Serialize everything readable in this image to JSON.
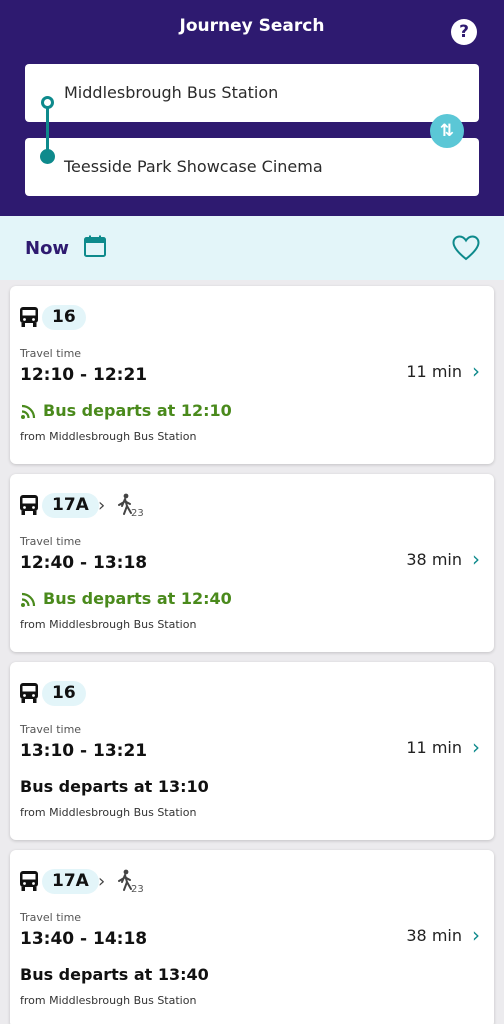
{
  "header": {
    "title": "Journey Search",
    "help_label": "?",
    "from": "Middlesbrough Bus Station",
    "to": "Teesside Park Showcase Cinema",
    "swap_label": "⇅"
  },
  "time_bar": {
    "now_label": "Now"
  },
  "colors": {
    "header_bg": "#2e1a70",
    "accent_teal": "#0e8a8c",
    "swap_btn": "#5bc7d6",
    "live_green": "#4a8a1c",
    "time_bar_bg": "#e3f5f9"
  },
  "icons": {
    "calendar": "calendar-icon",
    "favourite": "heart-icon",
    "bus": "bus-icon",
    "walk": "walk-icon",
    "live": "realtime-signal-icon"
  },
  "journeys": [
    {
      "route": "16",
      "walk_minutes": "",
      "travel_time_label": "Travel time",
      "times": "12:10 - 12:21",
      "duration": "11 min",
      "departs": "Bus departs at 12:10",
      "live": true,
      "from": "from Middlesbrough Bus Station"
    },
    {
      "route": "17A",
      "walk_minutes": "23",
      "travel_time_label": "Travel time",
      "times": "12:40 - 13:18",
      "duration": "38 min",
      "departs": "Bus departs at 12:40",
      "live": true,
      "from": "from Middlesbrough Bus Station"
    },
    {
      "route": "16",
      "walk_minutes": "",
      "travel_time_label": "Travel time",
      "times": "13:10 - 13:21",
      "duration": "11 min",
      "departs": "Bus departs at 13:10",
      "live": false,
      "from": "from Middlesbrough Bus Station"
    },
    {
      "route": "17A",
      "walk_minutes": "23",
      "travel_time_label": "Travel time",
      "times": "13:40 - 14:18",
      "duration": "38 min",
      "departs": "Bus departs at 13:40",
      "live": false,
      "from": "from Middlesbrough Bus Station"
    }
  ]
}
